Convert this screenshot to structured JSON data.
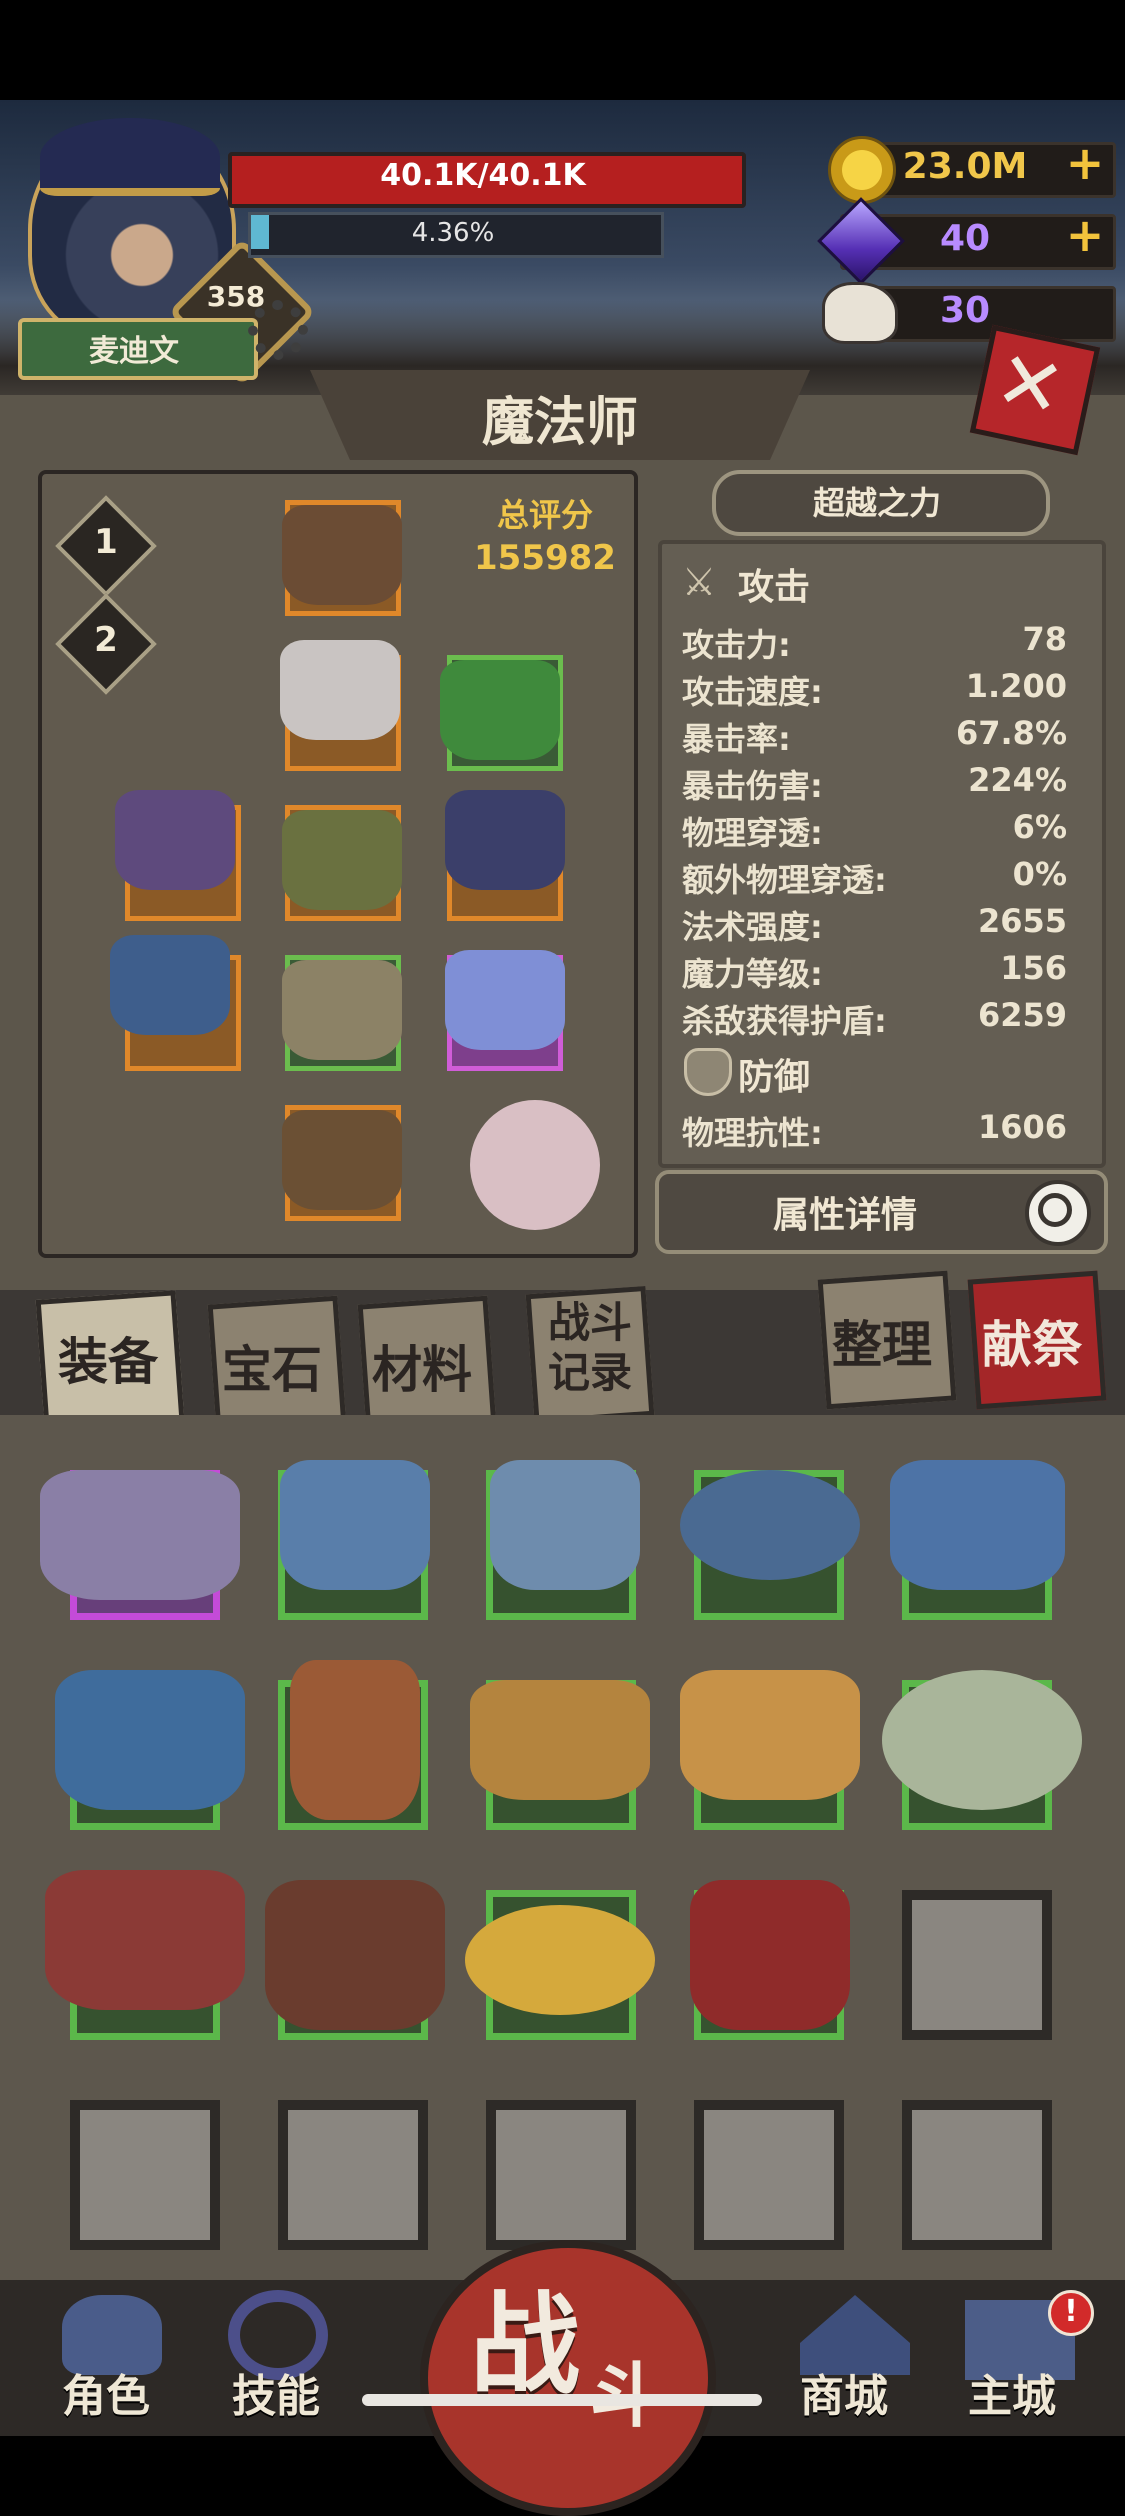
{
  "player": {
    "name": "麦迪文",
    "level": "358",
    "hp": "40.1K/40.1K",
    "xp": "4.36%",
    "xp_progress": 0.0436
  },
  "resources": {
    "gold": "23.0M",
    "gems": "40",
    "skulls": "30"
  },
  "class_title": "魔法师",
  "loadout": {
    "presets": [
      "1",
      "2"
    ],
    "score_label": "总评分",
    "score_value": "155982"
  },
  "transcend_button": "超越之力",
  "stats": {
    "attack_title": "攻击",
    "attack": [
      {
        "label": "攻击力:",
        "value": "78"
      },
      {
        "label": "攻击速度:",
        "value": "1.200"
      },
      {
        "label": "暴击率:",
        "value": "67.8%"
      },
      {
        "label": "暴击伤害:",
        "value": "224%"
      },
      {
        "label": "物理穿透:",
        "value": "6%"
      },
      {
        "label": "额外物理穿透:",
        "value": "0%"
      },
      {
        "label": "法术强度:",
        "value": "2655"
      },
      {
        "label": "魔力等级:",
        "value": "156"
      },
      {
        "label": "杀敌获得护盾:",
        "value": "6259"
      }
    ],
    "defense_title": "防御",
    "defense": [
      {
        "label": "物理抗性:",
        "value": "1606"
      }
    ]
  },
  "details_button": "属性详情",
  "tabs": {
    "equipment": "装备",
    "gems": "宝石",
    "materials": "材料",
    "battle_log": "战斗记录",
    "sort": "整理",
    "sacrifice": "献祭"
  },
  "nav": {
    "character": "角色",
    "skills": "技能",
    "fight": "战斗",
    "shop": "商城",
    "main_city": "主城",
    "main_city_badge": "!"
  },
  "colors": {
    "hp": "#b51f1f",
    "gold_text": "#f0c64a",
    "gem_text": "#b88bff",
    "rarity_orange": "#e0882a",
    "rarity_green": "#5bb84a",
    "rarity_purple": "#c44bd8"
  }
}
